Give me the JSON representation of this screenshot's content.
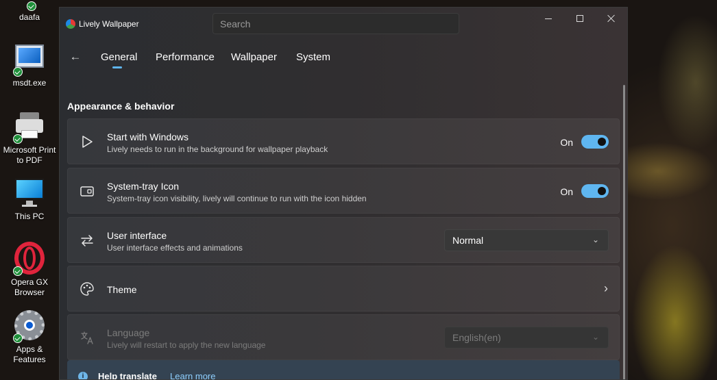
{
  "desktop": {
    "items": [
      {
        "label": "daafa"
      },
      {
        "label": "msdt.exe"
      },
      {
        "label": "Microsoft Print to PDF"
      },
      {
        "label": "This PC"
      },
      {
        "label": "Opera GX Browser"
      },
      {
        "label": "Apps & Features"
      }
    ]
  },
  "window": {
    "title": "Lively Wallpaper",
    "search_placeholder": "Search"
  },
  "nav": {
    "tabs": [
      "General",
      "Performance",
      "Wallpaper",
      "System"
    ],
    "active_tab": "General"
  },
  "section": {
    "title": "Appearance & behavior"
  },
  "settings": [
    {
      "title": "Start with Windows",
      "desc": "Lively needs to run in the background for wallpaper playback",
      "control": "toggle",
      "value": "On",
      "icon": "play-icon"
    },
    {
      "title": "System-tray Icon",
      "desc": "System-tray icon visibility, lively will continue to run with the icon hidden",
      "control": "toggle",
      "value": "On",
      "icon": "tray-icon"
    },
    {
      "title": "User interface",
      "desc": "User interface effects and animations",
      "control": "dropdown",
      "value": "Normal",
      "icon": "swap-arrows-icon"
    },
    {
      "title": "Theme",
      "desc": "",
      "control": "arrow",
      "icon": "palette-icon"
    },
    {
      "title": "Language",
      "desc": "Lively will restart to apply the new language",
      "control": "dropdown",
      "value": "English(en)",
      "disabled": true,
      "icon": "translate-icon"
    }
  ],
  "info_bar": {
    "title": "Help translate",
    "link": "Learn more"
  },
  "colors": {
    "accent": "#5fb6f0",
    "window_bg": "#2b2d31"
  }
}
